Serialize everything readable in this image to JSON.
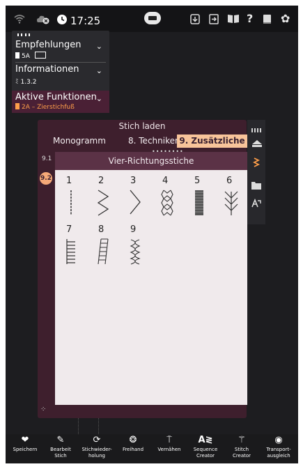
{
  "status": {
    "time": "17:25",
    "icons": [
      "wifi-icon",
      "cloud-status-icon",
      "clock-icon",
      "machine-icon",
      "download-icon",
      "exit-icon",
      "book-icon",
      "help-icon",
      "book-icon",
      "gear-icon"
    ]
  },
  "info_panel": {
    "recommendations": {
      "title": "Empfehlungen",
      "value": "5A"
    },
    "information": {
      "title": "Informationen",
      "value": "1.3.2"
    },
    "active_functions": {
      "title": "Aktive Funktionen",
      "value": "2A – Zierstichfuß"
    }
  },
  "dialog": {
    "title": "Stich laden",
    "tabs": [
      "Monogramm",
      "8. Techniken",
      "9. Zusätzliche"
    ],
    "active_tab": "9. Zusätzliche",
    "subcategory": "Vier-Richtungsstiche",
    "side_tabs": [
      "9.1",
      "9.2"
    ],
    "selected_side_tab": "9.2",
    "stitches": [
      {
        "num": "1"
      },
      {
        "num": "2"
      },
      {
        "num": "3"
      },
      {
        "num": "4"
      },
      {
        "num": "5"
      },
      {
        "num": "6"
      },
      {
        "num": "7"
      },
      {
        "num": "8"
      },
      {
        "num": "9"
      }
    ]
  },
  "toolbar": {
    "items": [
      {
        "label": "Speichern",
        "icon": "heart-icon"
      },
      {
        "label": "Bearbeit\nStich",
        "icon": "edit-stitch-icon"
      },
      {
        "label": "Stichwieder-\nholung",
        "icon": "repeat-icon"
      },
      {
        "label": "Freihand",
        "icon": "freehand-icon"
      },
      {
        "label": "Vernähen",
        "icon": "tie-off-icon"
      },
      {
        "label": "Sequence\nCreator",
        "icon": "sequence-icon"
      },
      {
        "label": "Stitch\nCreator",
        "icon": "stitch-creator-icon"
      },
      {
        "label": "Transport-\nausgleich",
        "icon": "balance-icon"
      }
    ]
  },
  "colors": {
    "accent": "#f8c49a",
    "dialog_bg": "#3e1f2d",
    "active_function": "#ff9f4a"
  }
}
